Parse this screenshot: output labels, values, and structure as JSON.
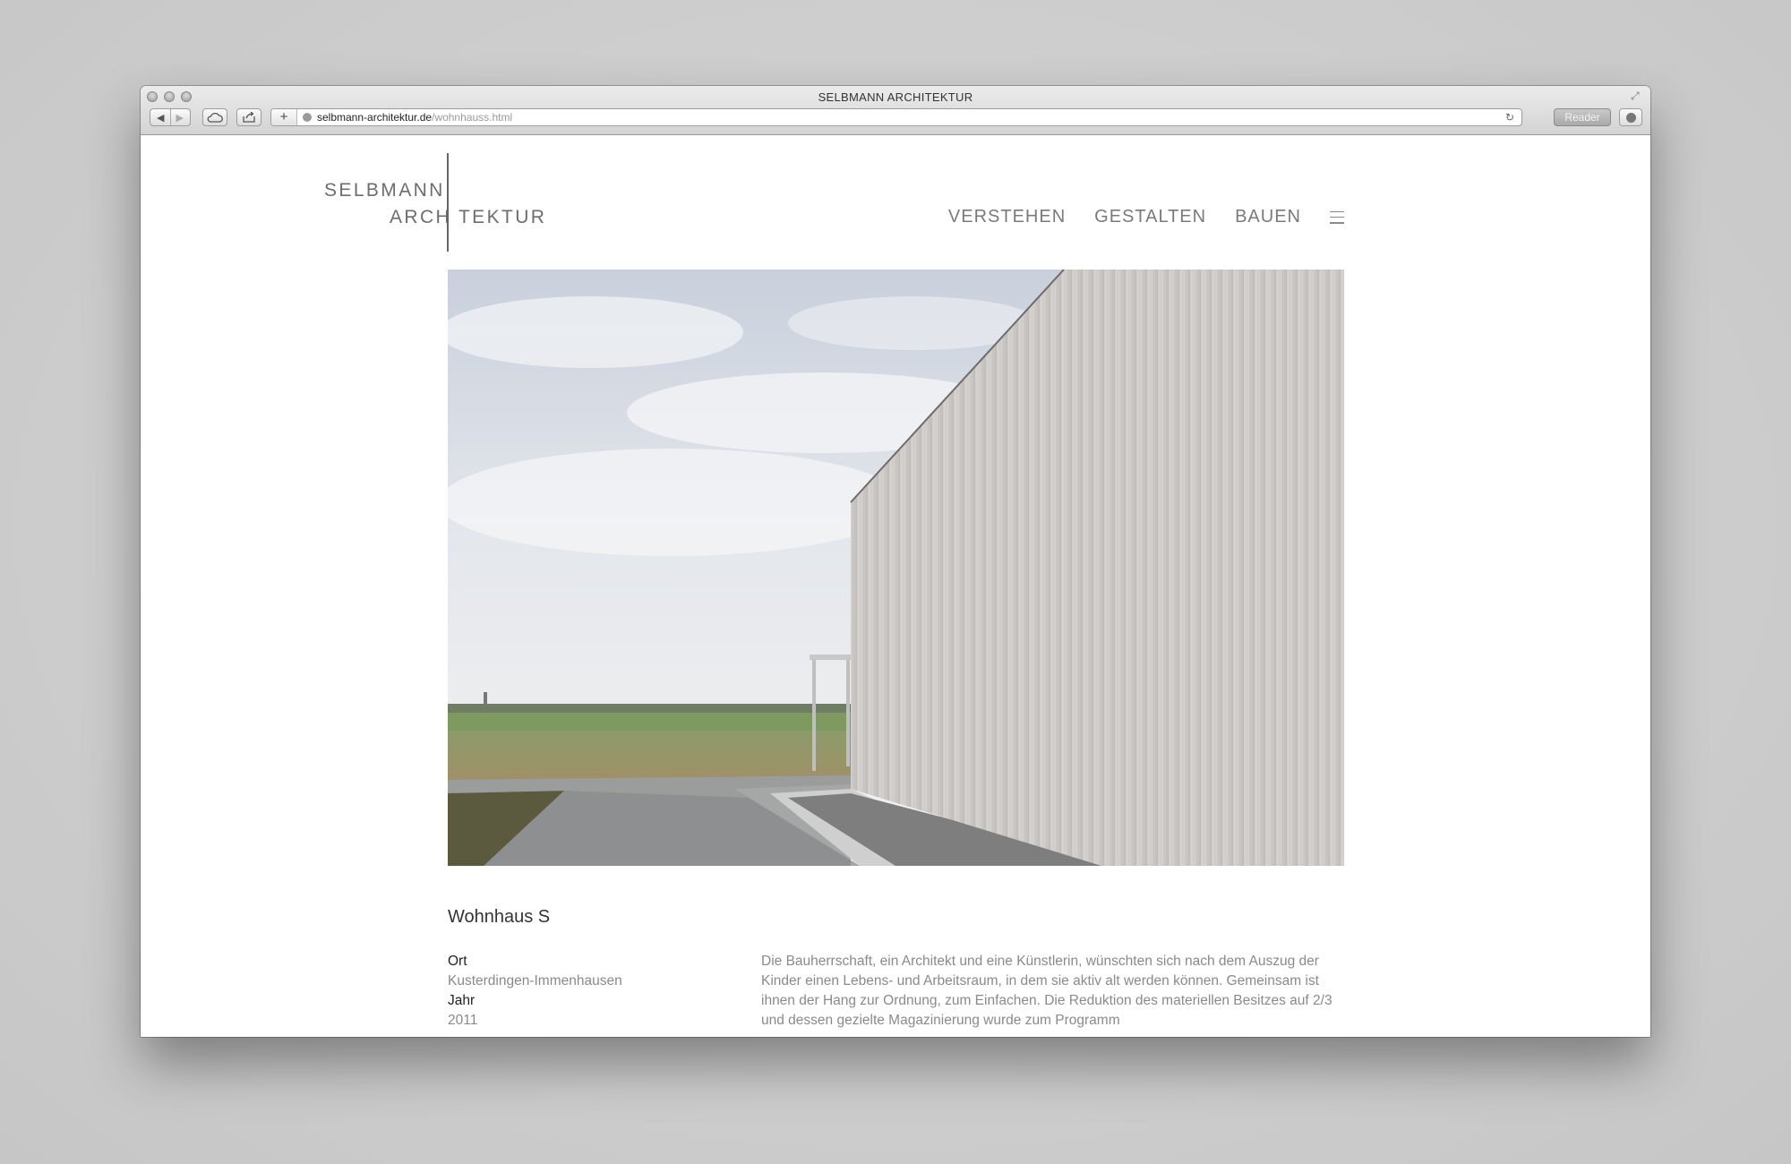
{
  "window": {
    "title": "SELBMANN ARCHITEKTUR"
  },
  "toolbar": {
    "url_domain": "selbmann-architektur.de",
    "url_path": "/wohnhauss.html",
    "reader_label": "Reader"
  },
  "logo": {
    "line1": "SELBMANN",
    "line2": "ARCH TEKTUR"
  },
  "nav": {
    "items": [
      "VERSTEHEN",
      "GESTALTEN",
      "BAUEN"
    ]
  },
  "project": {
    "title": "Wohnhaus S",
    "meta": [
      {
        "label": "Ort",
        "value": "Kusterdingen-Immenhausen"
      },
      {
        "label": "Jahr",
        "value": "2011"
      }
    ],
    "description": "Die Bauherrschaft, ein Architekt und eine Künstlerin, wünschten sich nach dem Auszug der Kinder einen Lebens- und Arbeitsraum, in dem sie aktiv alt werden können. Gemeinsam ist ihnen der Hang zur Ordnung, zum Einfachen. Die Reduktion des materiellen Besitzes auf 2/3 und dessen gezielte Magazinierung wurde zum Programm"
  },
  "icons": {
    "back": "back-arrow-icon",
    "forward": "forward-arrow-icon",
    "cloud": "icloud-tabs-icon",
    "share": "share-icon",
    "new_tab": "plus-icon",
    "site": "globe-icon",
    "reload": "reload-icon",
    "downloads": "downloads-icon",
    "fullscreen": "fullscreen-icon",
    "menu": "hamburger-menu-icon"
  }
}
